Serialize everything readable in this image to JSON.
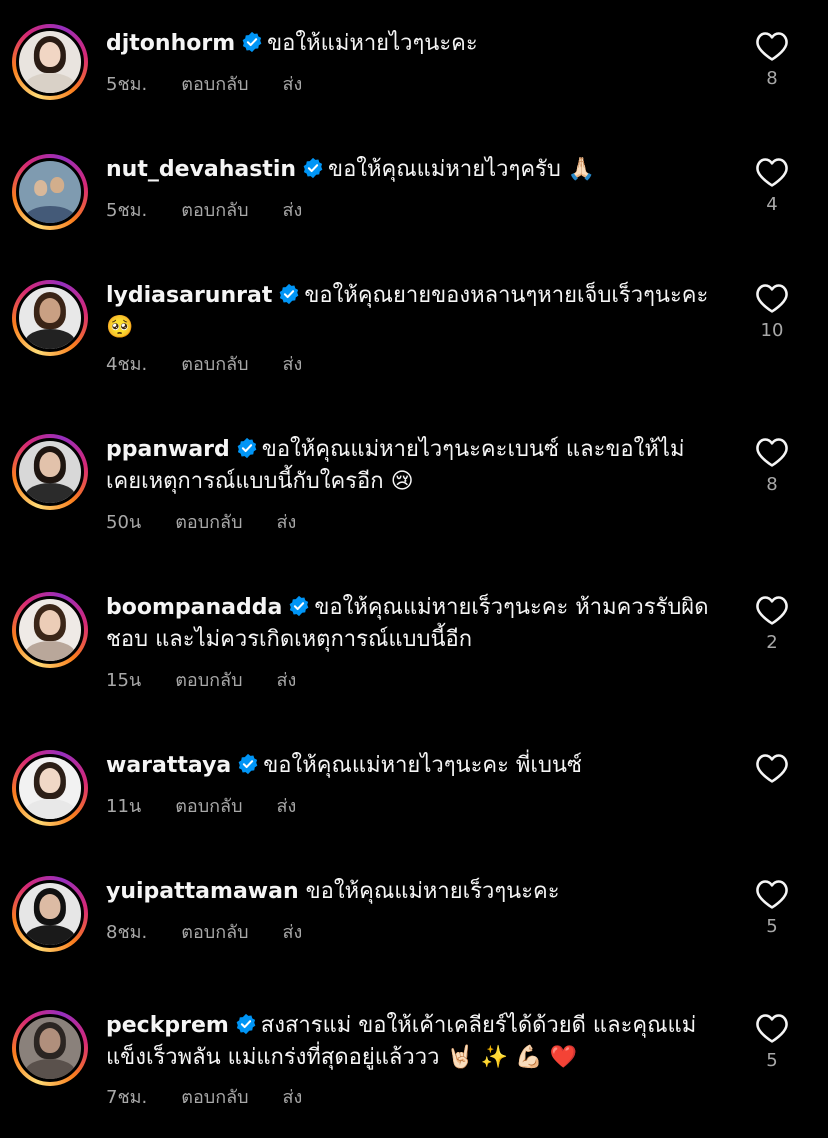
{
  "ui": {
    "reply_label": "ตอบกลับ",
    "send_label": "ส่ง"
  },
  "comments": [
    {
      "username": "djtonhorm",
      "verified": true,
      "lines": [
        "ขอให้แม่หายไวๆนะคะ"
      ],
      "time": "5ชม.",
      "likes": "8"
    },
    {
      "username": "nut_devahastin",
      "verified": true,
      "lines": [
        "ขอให้คุณแม่หายไวๆครับ 🙏🏻"
      ],
      "time": "5ชม.",
      "likes": "4"
    },
    {
      "username": "lydiasarunrat",
      "verified": true,
      "lines": [
        "ขอให้คุณยายของหลานๆหายเจ็บเร็วๆนะคะ",
        "🥺"
      ],
      "time": "4ชม.",
      "likes": "10"
    },
    {
      "username": "ppanward",
      "verified": true,
      "lines": [
        "ขอให้คุณแม่หายไวๆนะคะเบนซ์ และขอให้ไม่",
        "เคยเหตุการณ์แบบนี้กับใครอีก 😢"
      ],
      "time": "50น",
      "likes": "8"
    },
    {
      "username": "boompanadda",
      "verified": true,
      "lines": [
        "ขอให้คุณแม่หายเร็วๆนะคะ ห้ามควรรับผิด",
        "ชอบ และไม่ควรเกิดเหตุการณ์แบบนี้อีก"
      ],
      "time": "15น",
      "likes": "2"
    },
    {
      "username": "warattaya",
      "verified": true,
      "lines": [
        "ขอให้คุณแม่หายไวๆนะคะ พี่เบนซ์"
      ],
      "time": "11น",
      "likes": ""
    },
    {
      "username": "yuipattamawan",
      "verified": false,
      "lines": [
        "ขอให้คุณแม่หายเร็วๆนะคะ"
      ],
      "time": "8ชม.",
      "likes": "5"
    },
    {
      "username": "peckprem",
      "verified": true,
      "lines": [
        "สงสารแม่ ขอให้เค้าเคลียร์ได้ด้วยดี และคุณแม่",
        "แข็งเร็วพลัน แม่แกร่งที่สุดอยู่แล้ววว 🤘🏻 ✨ 💪🏻 ❤️"
      ],
      "time": "7ชม.",
      "likes": "5"
    }
  ],
  "colors": {
    "background": "#000000",
    "text": "#f5f5f5",
    "secondary_text": "#a8a8a8",
    "verified_badge": "#0095f6"
  },
  "icons": {
    "verified": "verified-badge-icon",
    "like": "heart-outline-icon"
  }
}
